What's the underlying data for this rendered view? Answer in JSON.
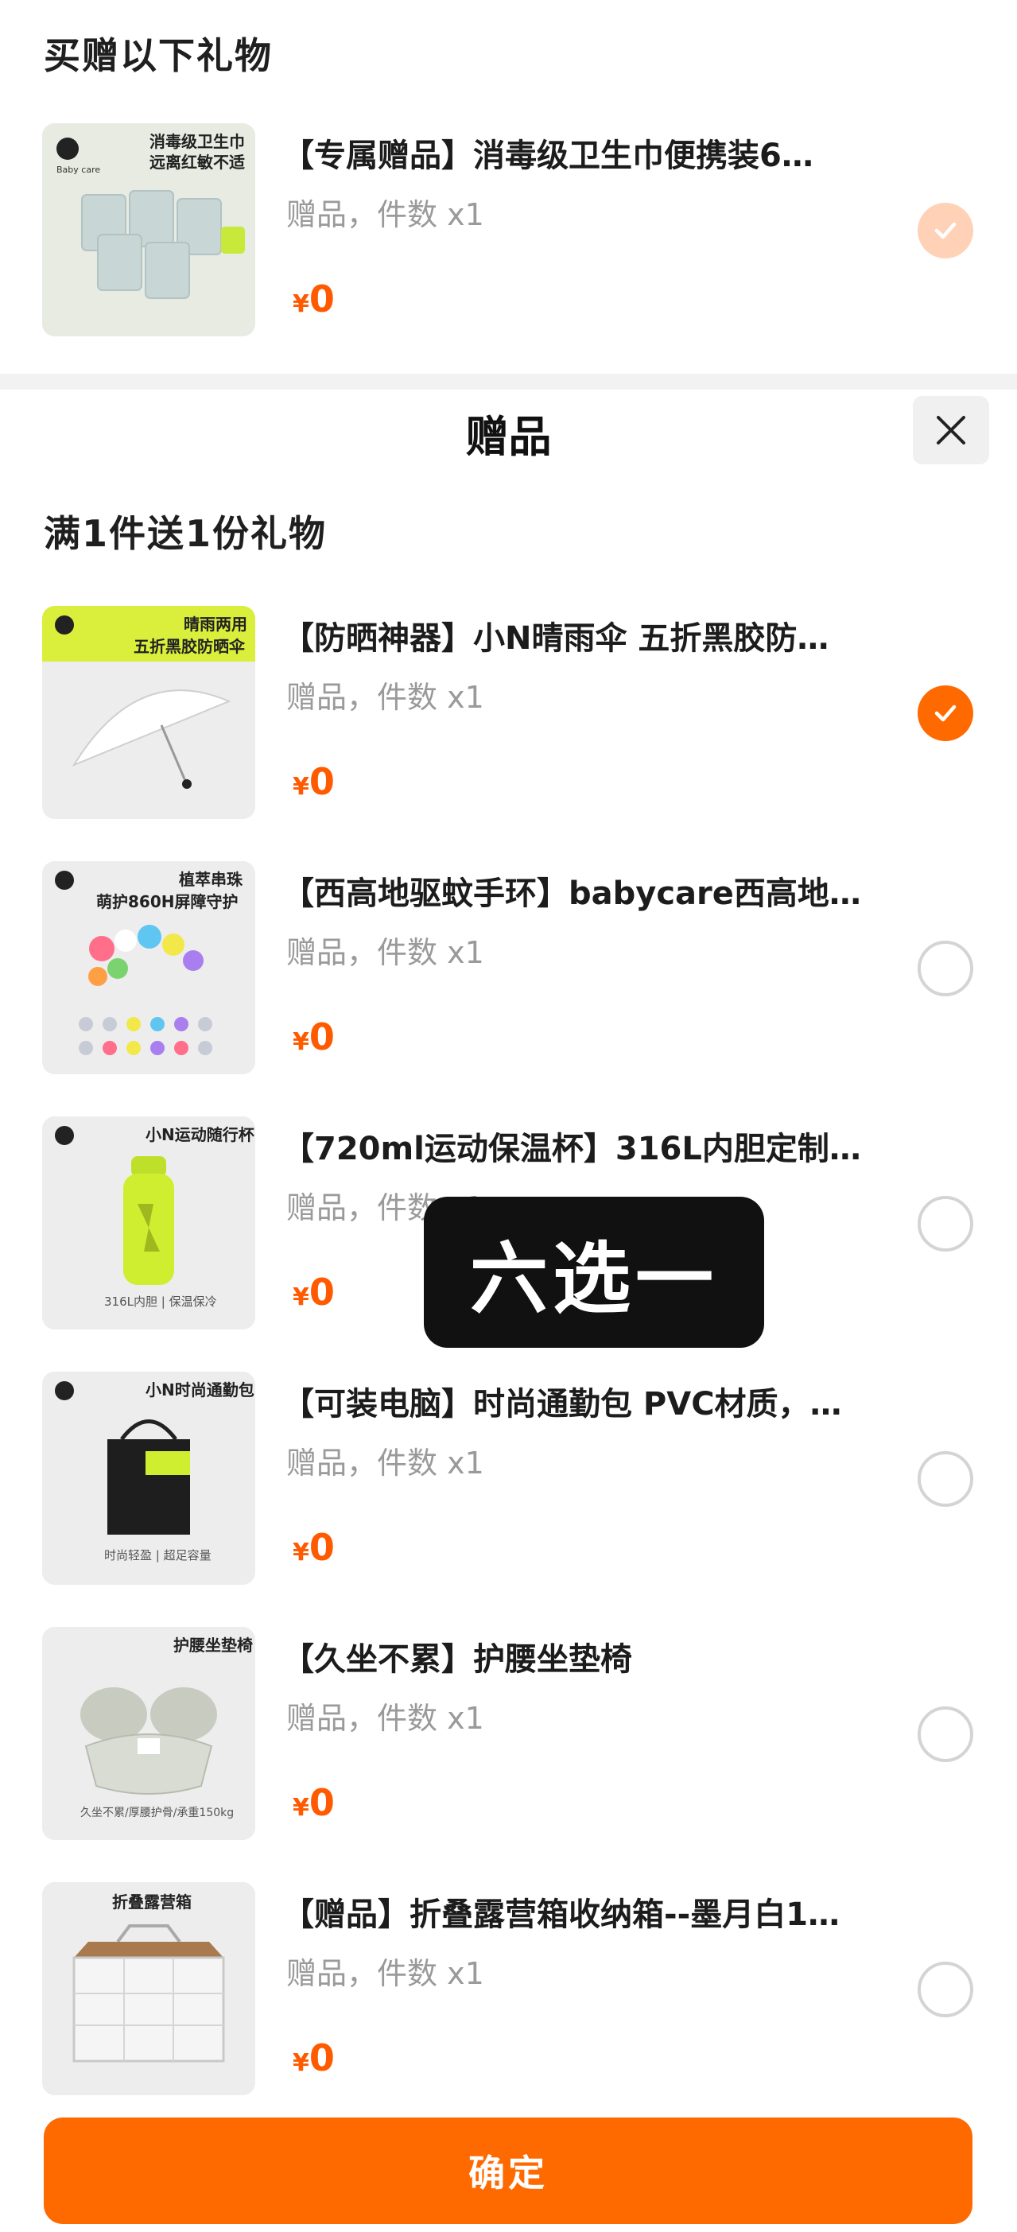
{
  "top_section": {
    "title": "买赠以下礼物",
    "item": {
      "title": "【专属赠品】消毒级卫生巾便携装6…",
      "meta": "赠品，件数 x1",
      "price_symbol": "¥",
      "price": "0",
      "thumb_caption_1": "消毒级卫生巾",
      "thumb_caption_2": "远离红敏不适",
      "brand": "Baby care",
      "selected": true
    }
  },
  "sheet": {
    "title": "赠品",
    "close_icon": "close-icon",
    "rule_title": "满1件送1份礼物",
    "items": [
      {
        "title": "【防晒神器】小N晴雨伞 五折黑胶防…",
        "meta": "赠品，件数 x1",
        "price_symbol": "¥",
        "price": "0",
        "thumb_caption_1": "晴雨两用",
        "thumb_caption_2": "五折黑胶防晒伞",
        "selected": true
      },
      {
        "title": "【西高地驱蚊手环】babycare西高地…",
        "meta": "赠品，件数 x1",
        "price_symbol": "¥",
        "price": "0",
        "thumb_caption_1": "植萃串珠",
        "thumb_caption_2": "萌护860H屏障守护",
        "selected": false
      },
      {
        "title": "【720ml运动保温杯】316L内胆定制…",
        "meta": "赠品，件数 x1",
        "price_symbol": "¥",
        "price": "0",
        "thumb_caption_1": "小N运动随行杯",
        "thumb_caption_2": "316L内胆 | 保温保冷",
        "selected": false
      },
      {
        "title": "【可装电脑】时尚通勤包 PVC材质，…",
        "meta": "赠品，件数 x1",
        "price_symbol": "¥",
        "price": "0",
        "thumb_caption_1": "小N时尚通勤包",
        "thumb_caption_2": "时尚轻盈 | 超足容量",
        "selected": false
      },
      {
        "title": "【久坐不累】护腰坐垫椅",
        "meta": "赠品，件数 x1",
        "price_symbol": "¥",
        "price": "0",
        "thumb_caption_1": "护腰坐垫椅",
        "thumb_caption_2": "久坐不累/厚腰护骨/承重150kg",
        "selected": false
      },
      {
        "title": "【赠品】折叠露营箱收纳箱--墨月白1…",
        "meta": "赠品，件数 x1",
        "price_symbol": "¥",
        "price": "0",
        "thumb_caption_1": "折叠露营箱",
        "thumb_caption_2": "",
        "selected": false
      }
    ],
    "overlay_badge": "六选一",
    "confirm_label": "确定"
  },
  "colors": {
    "accent": "#ff6a00",
    "accent_faded": "#ffd2b8",
    "price": "#ff5a00",
    "meta_text": "#9a9a9a",
    "title_text": "#1c1c1c"
  }
}
